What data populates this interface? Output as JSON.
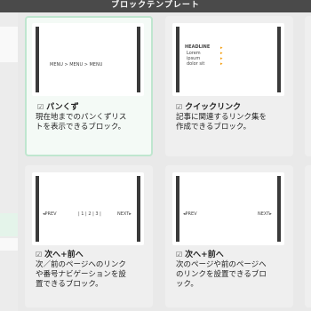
{
  "window": {
    "title": "ブロックテンプレート"
  },
  "cards": [
    {
      "title": "パンくず",
      "description": "現在地までのパンくずリス\nトを表示できるブロック。",
      "preview": {
        "text": "MENU > MENU > MENU"
      }
    },
    {
      "title": "クイックリンク",
      "description": "記事に関連するリンク集を\n作成できるブロック。",
      "preview": {
        "headline": "HEADLINE",
        "lines": [
          "Lorem",
          "ipsum",
          "dolor sit"
        ]
      }
    },
    {
      "title": "次へ+前へ",
      "description": "次／前のページへのリンク\nや番号ナビゲーションを設\n置できるブロック。",
      "preview": {
        "prev": "◂PREV",
        "pages": "| 1 | 2 | 3 |",
        "next": "NEXT▸"
      }
    },
    {
      "title": "次へ+前へ",
      "description": "次のページや前のページへ\nのリンクを設置できるブロ\nック。",
      "preview": {
        "prev": "◂PREV",
        "next": "NEXT▸"
      }
    }
  ],
  "icons": {
    "checkbox": "☑",
    "arrow": "▸"
  },
  "colors": {
    "accent": "#bfe6cf",
    "titlebar": "#4a4a4a",
    "link_arrow": "#f39800"
  }
}
